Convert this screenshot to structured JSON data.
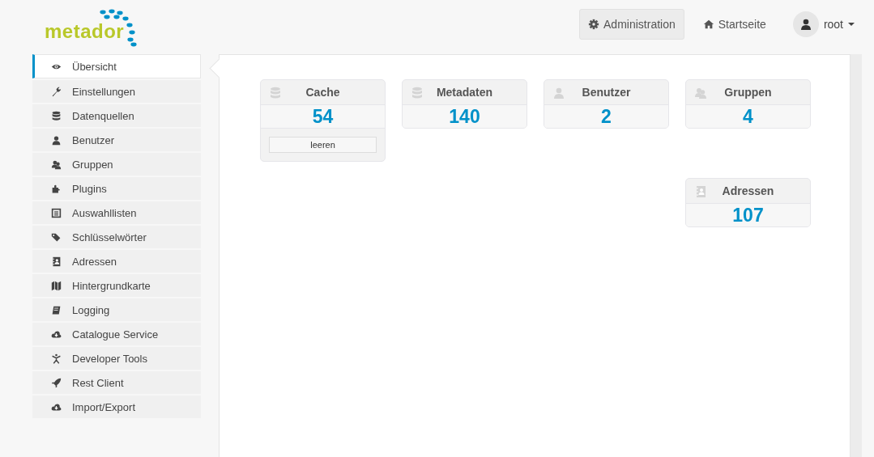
{
  "logo": {
    "text": "metador"
  },
  "nav": [
    {
      "label": "Administration",
      "kind": "gear",
      "selected": true
    },
    {
      "label": "Startseite",
      "kind": "home",
      "selected": false
    }
  ],
  "user": {
    "name": "root"
  },
  "sidebar": {
    "items": [
      {
        "label": "Übersicht",
        "kind": "eye",
        "selected": true
      },
      {
        "label": "Einstellungen",
        "kind": "wrench",
        "selected": false
      },
      {
        "label": "Datenquellen",
        "kind": "database",
        "selected": false
      },
      {
        "label": "Benutzer",
        "kind": "user",
        "selected": false
      },
      {
        "label": "Gruppen",
        "kind": "users",
        "selected": false
      },
      {
        "label": "Plugins",
        "kind": "puzzle",
        "selected": false
      },
      {
        "label": "Auswahllisten",
        "kind": "list",
        "selected": false
      },
      {
        "label": "Schlüsselwörter",
        "kind": "tags",
        "selected": false
      },
      {
        "label": "Adressen",
        "kind": "addressbook",
        "selected": false
      },
      {
        "label": "Hintergrundkarte",
        "kind": "map",
        "selected": false
      },
      {
        "label": "Logging",
        "kind": "book",
        "selected": false
      },
      {
        "label": "Catalogue Service",
        "kind": "cloud",
        "selected": false
      },
      {
        "label": "Developer Tools",
        "kind": "figure",
        "selected": false
      },
      {
        "label": "Rest Client",
        "kind": "rocket",
        "selected": false
      },
      {
        "label": "Import/Export",
        "kind": "cloud",
        "selected": false
      }
    ]
  },
  "card_rows": [
    [
      {
        "title": "Cache",
        "kind": "database",
        "value": "54",
        "button": "leeren"
      },
      {
        "title": "Metadaten",
        "kind": "database",
        "value": "140"
      },
      {
        "title": "Benutzer",
        "kind": "user",
        "value": "2"
      },
      {
        "title": "Gruppen",
        "kind": "users",
        "value": "4"
      }
    ],
    [
      {
        "title": "Adressen",
        "kind": "addressbook",
        "value": "107"
      }
    ]
  ]
}
